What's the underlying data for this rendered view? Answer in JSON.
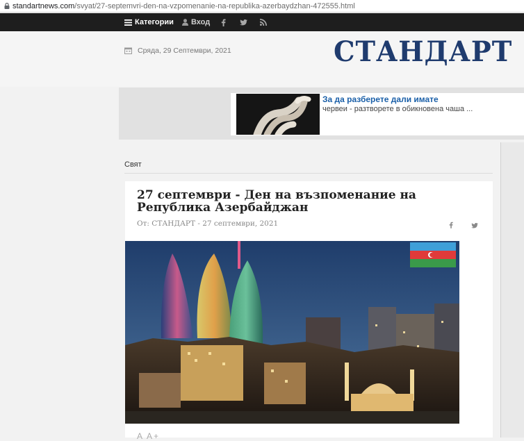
{
  "browser": {
    "url_host": "standartnews.com",
    "url_path": "/svyat/27-septemvri-den-na-vzpomenanie-na-republika-azerbaydzhan-472555.html"
  },
  "nav": {
    "categories_label": "Категории",
    "login_label": "Вход"
  },
  "header": {
    "date": "Сряда, 29 Септември, 2021",
    "logo": "СТАНДАРТ"
  },
  "ad": {
    "title": "За да разберете дали имате",
    "text": "червеи - разтворете в обикновена чаша ..."
  },
  "section": {
    "label": "Свят"
  },
  "article": {
    "title": "27 септември - Ден на възпоменание на Република Азербайджан",
    "byline": "От: СТАНДАРТ - 27 септември, 2021",
    "font_size_control": "A A+"
  },
  "colors": {
    "nav_bg": "#1e1e1e",
    "logo": "#1f3b6e",
    "ad_link": "#1a5fa8"
  }
}
